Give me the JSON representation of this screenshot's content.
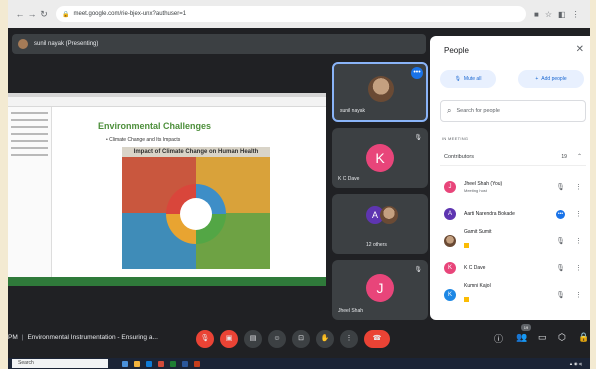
{
  "browser": {
    "url": "meet.google.com/rie-bjex-unx?authuser=1"
  },
  "meeting": {
    "presenter_label": "sunil nayak (Presenting)",
    "time_prefix": "PM",
    "title": "Environmental Instrumentation - Ensuring a..."
  },
  "slide": {
    "title": "Environmental Challenges",
    "bullet": "Climate Change and Its Impacts",
    "infographic_title": "Impact of Climate Change on Human Health"
  },
  "tiles": [
    {
      "name": "sunil nayak"
    },
    {
      "name": "K C Dave",
      "initial": "K"
    },
    {
      "name": "12 others",
      "initial": "A"
    },
    {
      "name": "Jheel Shah",
      "initial": "J"
    }
  ],
  "people_panel": {
    "title": "People",
    "mute_all": "Mute all",
    "add_people": "Add people",
    "search_placeholder": "Search for people",
    "section": "IN MEETING",
    "group": "Contributors",
    "group_count": "19",
    "participants": [
      {
        "name": "Jheel Shah (You)",
        "role": "Meeting host",
        "initial": "J",
        "color": "#e8457a"
      },
      {
        "name": "Aarti Narendra Bokade",
        "role": "",
        "initial": "A",
        "color": "#5e35b1"
      },
      {
        "name": "Gamit Sumit",
        "role": "",
        "initial": "",
        "color": "#8d6e63"
      },
      {
        "name": "K C Dave",
        "role": "",
        "initial": "K",
        "color": "#e8457a"
      },
      {
        "name": "Kumni Kajol",
        "role": "",
        "initial": "K",
        "color": "#1e88e5"
      }
    ]
  },
  "taskbar": {
    "search_placeholder": "Search"
  },
  "colors": {
    "accent_blue": "#1a73e8",
    "hangup_red": "#ea4335",
    "dark_bg": "#202124",
    "tile_bg": "#3c4043"
  }
}
